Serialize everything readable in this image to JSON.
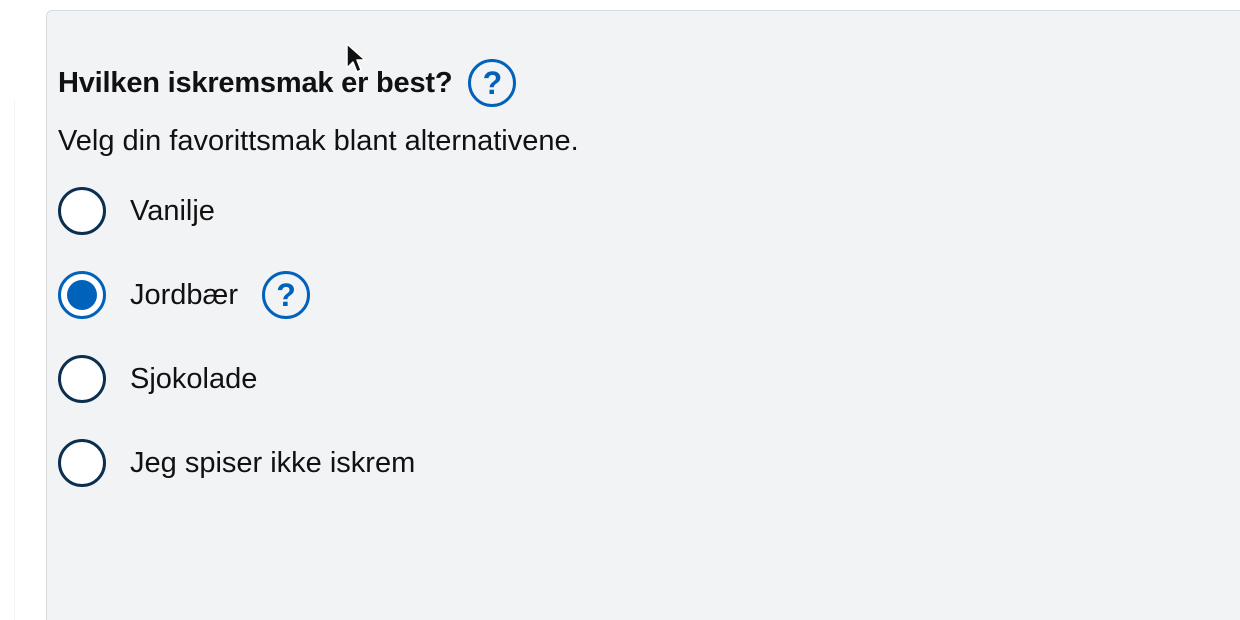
{
  "question": {
    "legend": "Hvilken iskremsmak er best?",
    "help_glyph": "?",
    "description": "Velg din favorittsmak blant alternativene."
  },
  "options": [
    {
      "label": "Vanilje",
      "checked": false,
      "has_help": false
    },
    {
      "label": "Jordbær",
      "checked": true,
      "has_help": true,
      "help_glyph": "?"
    },
    {
      "label": "Sjokolade",
      "checked": false,
      "has_help": false
    },
    {
      "label": "Jeg spiser ikke iskrem",
      "checked": false,
      "has_help": false
    }
  ],
  "colors": {
    "accent": "#0062ba",
    "radio_border": "#0c2f4f",
    "panel_bg": "#f2f3f5",
    "text": "#111111"
  },
  "icons": {
    "help": "question-circle-icon",
    "cursor": "mouse-pointer-icon"
  }
}
